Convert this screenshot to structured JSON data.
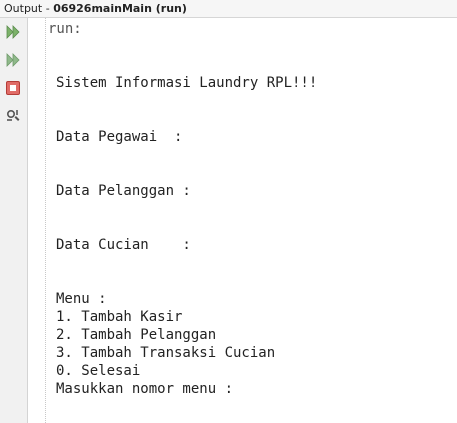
{
  "titlebar": {
    "label": "Output - ",
    "tab": "06926mainMain (run)"
  },
  "toolbar": [
    {
      "icon": "rerun-icon"
    },
    {
      "icon": "rerun-with-options-icon"
    },
    {
      "icon": "stop-icon"
    },
    {
      "icon": "settings-icon"
    }
  ],
  "console": {
    "run_label": "run:",
    "title_line": "Sistem Informasi Laundry RPL!!!",
    "pegawai_line": "Data Pegawai  :",
    "pelanggan_line": "Data Pelanggan :",
    "cucian_line": "Data Cucian    :",
    "menu_header": "Menu :",
    "menu_items": [
      "1. Tambah Kasir",
      "2. Tambah Pelanggan",
      "3. Tambah Transaksi Cucian",
      "0. Selesai"
    ],
    "prompt": "Masukkan nomor menu :"
  },
  "colors": {
    "play_green": "#7cb26a",
    "stop_red": "#d9534f"
  }
}
